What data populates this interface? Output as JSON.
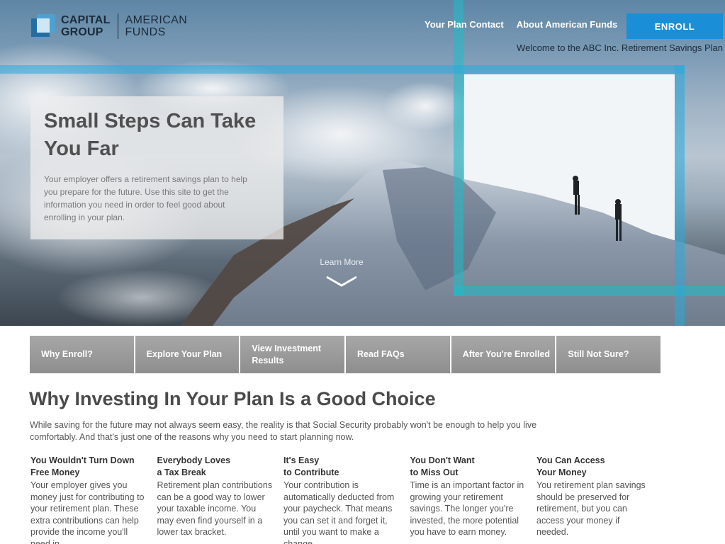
{
  "header": {
    "logo_line1": "CAPITAL",
    "logo_line2": "GROUP",
    "logo_line3": "AMERICAN",
    "logo_line4": "FUNDS",
    "nav": [
      {
        "label": "Your Plan Contact"
      },
      {
        "label": "About American Funds"
      }
    ],
    "enroll_label": "ENROLL",
    "welcome": "Welcome to the ABC Inc. Retirement Savings Plan"
  },
  "hero": {
    "title": "Small Steps Can Take You Far",
    "body": "Your employer offers a retirement savings plan to help you prepare for the future. Use this site to get the information you need in order to feel good about enrolling in your plan.",
    "learn_more": "Learn More"
  },
  "tabs": [
    {
      "label": "Why Enroll?"
    },
    {
      "label": "Explore Your Plan"
    },
    {
      "label": "View Investment Results"
    },
    {
      "label": "Read FAQs"
    },
    {
      "label": "After You're Enrolled"
    },
    {
      "label": "Still Not Sure?"
    }
  ],
  "content": {
    "title": "Why Investing In Your Plan Is a Good Choice",
    "intro": "While saving for the future may not always seem easy, the reality is that Social Security probably won't be enough to help you live comfortably. And that's just one of the reasons why you need to start planning now.",
    "columns": [
      {
        "heading": "You Wouldn't Turn Down\nFree Money",
        "text": "Your employer gives you money just for contributing to your retirement plan. These extra contributions can help provide the income you'll need in"
      },
      {
        "heading": "Everybody Loves\na Tax Break",
        "text": "Retirement plan contributions can be a good way to lower your taxable income. You may even find yourself in a lower tax bracket."
      },
      {
        "heading": "It's Easy\nto Contribute",
        "text": "Your contribution is automatically deducted from your paycheck. That means you can set it and forget it, until you want to make a change."
      },
      {
        "heading": "You Don't Want\nto Miss Out",
        "text": "Time is an important factor in growing your retirement savings. The longer you're invested, the more potential you have to earn money."
      },
      {
        "heading": "You Can Access\nYour Money",
        "text": "You retirement plan savings should be preserved for retirement, but you can access your money if needed."
      }
    ]
  },
  "colors": {
    "accent": "#1a8fd8",
    "frame": "#28aadc",
    "tab": "#9a9a9a"
  }
}
